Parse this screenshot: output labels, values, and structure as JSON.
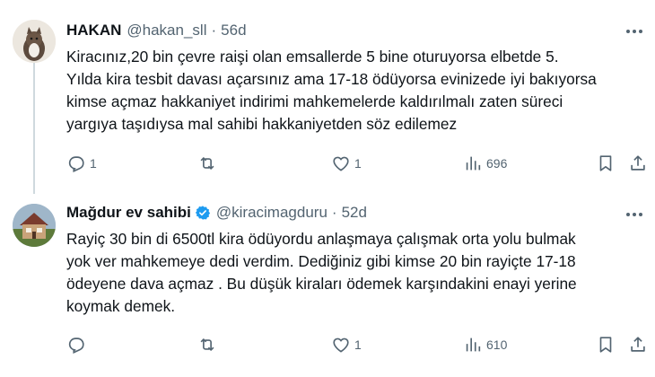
{
  "tweets": [
    {
      "name": "HAKAN",
      "handle": "@hakan_sll",
      "separator": "·",
      "time": "56d",
      "verified": false,
      "lines": [
        "Kiracınız,20 bin çevre raişi olan emsallerde 5 bine oturuyorsa elbetde 5.",
        "Yılda kira tesbit davası açarsınız ama 17-18 ödüyorsa evinizede iyi bakıyorsa",
        "kimse açmaz hakkaniyet indirimi mahkemelerde kaldırılmalı zaten süreci",
        "yargıya taşıdıysa mal sahibi hakkaniyetden söz edilemez"
      ],
      "replies": "1",
      "retweets": "",
      "likes": "1",
      "views": "696"
    },
    {
      "name": "Mağdur ev sahibi",
      "handle": "@kiracimagduru",
      "separator": "·",
      "time": "52d",
      "verified": true,
      "lines": [
        "Rayiç 30 bin di 6500tl kira ödüyordu anlaşmaya çalışmak orta yolu bulmak",
        "yok ver mahkemeye dedi verdim. Dediğiniz gibi kimse 20 bin rayiçte 17-18",
        "ödeyene dava açmaz . Bu düşük kiraları ödemek karşındakini enayi yerine",
        "koymak demek."
      ],
      "replies": "",
      "retweets": "",
      "likes": "1",
      "views": "610"
    }
  ],
  "icons": {
    "reply": "reply-icon",
    "retweet": "retweet-icon",
    "like": "heart-icon",
    "views": "views-icon",
    "bookmark": "bookmark-icon",
    "share": "share-icon",
    "more": "more-icon",
    "verified": "verified-badge-icon"
  },
  "colors": {
    "text": "#0f1419",
    "secondary": "#536471",
    "verified": "#1d9bf0",
    "thread_line": "#cfd9de"
  }
}
